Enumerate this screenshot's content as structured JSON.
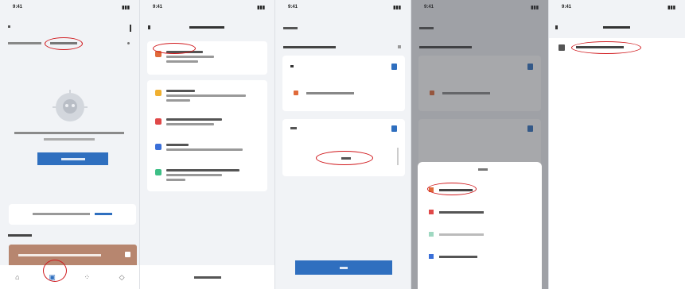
{
  "colors": {
    "accent": "#2f6fbf",
    "highlight_oval": "#d0191d",
    "banner": "#b7866f"
  },
  "status": {
    "time": "9:41",
    "signal": "4G"
  },
  "p1": {
    "center_text": "..",
    "button_label": "...",
    "link_text": "..."
  },
  "p2": {
    "bottom_button": "..."
  },
  "p3": {
    "title": "...",
    "bottom_button": "..."
  },
  "p5": {
    "nav_title": "..."
  }
}
